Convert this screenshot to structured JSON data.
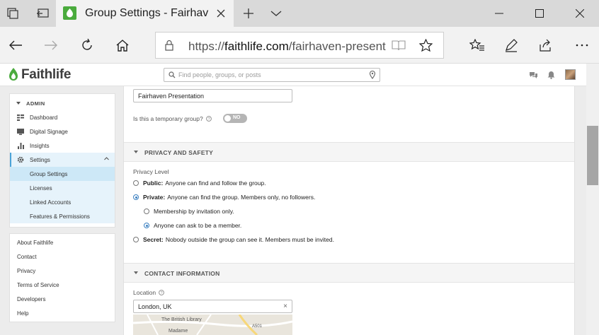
{
  "browser": {
    "tab_title": "Group Settings - Fairhaven Presentation",
    "url_prefix": "https://",
    "url_domain": "faithlife.com",
    "url_path": "/fairhaven-present"
  },
  "site": {
    "logo_text": "Faithlife",
    "search_placeholder": "Find people, groups, or posts"
  },
  "sidebar": {
    "admin_label": "ADMIN",
    "items": [
      {
        "label": "Dashboard",
        "icon": "dashboard-icon"
      },
      {
        "label": "Digital Signage",
        "icon": "signage-icon"
      },
      {
        "label": "Insights",
        "icon": "insights-icon"
      },
      {
        "label": "Settings",
        "icon": "gear-icon"
      }
    ],
    "settings_subitems": [
      {
        "label": "Group Settings"
      },
      {
        "label": "Licenses"
      },
      {
        "label": "Linked Accounts"
      },
      {
        "label": "Features & Permissions"
      }
    ],
    "links": [
      {
        "label": "About Faithlife"
      },
      {
        "label": "Contact"
      },
      {
        "label": "Privacy"
      },
      {
        "label": "Terms of Service"
      },
      {
        "label": "Developers"
      },
      {
        "label": "Help"
      }
    ]
  },
  "main": {
    "group_name": "Fairhaven Presentation",
    "temporary_question": "Is this a temporary group?",
    "temporary_toggle": "NO",
    "privacy": {
      "title": "PRIVACY AND SAFETY",
      "level_label": "Privacy Level",
      "options": [
        {
          "bold": "Public:",
          "text": "Anyone can find and follow the group."
        },
        {
          "bold": "Private:",
          "text": "Anyone can find the group. Members only, no followers."
        },
        {
          "bold": "Secret:",
          "text": "Nobody outside the group can see it. Members must be invited."
        }
      ],
      "sub_options": [
        {
          "text": "Membership by invitation only."
        },
        {
          "text": "Anyone can ask to be a member."
        }
      ]
    },
    "contact": {
      "title": "CONTACT INFORMATION",
      "location_label": "Location",
      "location_value": "London, UK",
      "map_labels": [
        "The British Library",
        "A501",
        "Madame"
      ]
    }
  },
  "colors": {
    "brand_green": "#4aab3d",
    "accent_blue": "#4ba3d8",
    "radio_blue": "#3a7fc0"
  }
}
